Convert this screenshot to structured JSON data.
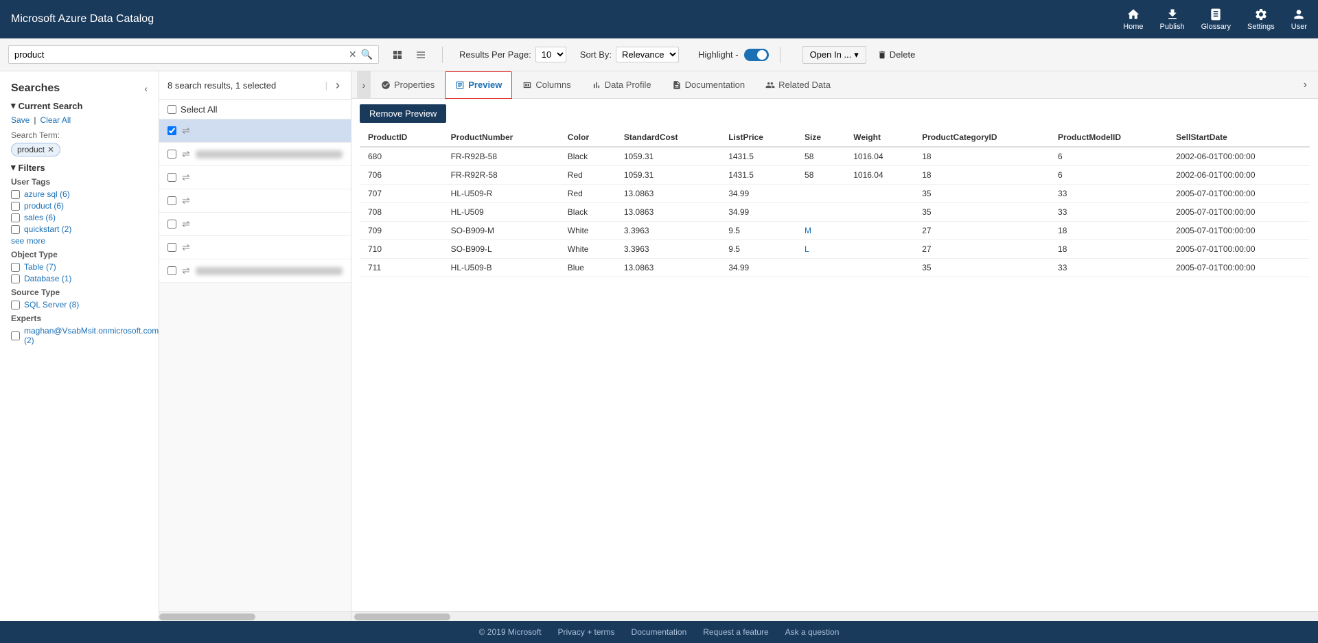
{
  "app": {
    "title": "Microsoft Azure Data Catalog"
  },
  "nav": {
    "home_label": "Home",
    "publish_label": "Publish",
    "glossary_label": "Glossary",
    "settings_label": "Settings",
    "user_label": "User"
  },
  "search_bar": {
    "query": "product",
    "results_per_page_label": "Results Per Page:",
    "results_per_page_value": "10",
    "sort_by_label": "Sort By:",
    "sort_by_value": "Relevance",
    "highlight_label": "Highlight -",
    "open_in_label": "Open In ...",
    "delete_label": "Delete"
  },
  "sidebar": {
    "title": "Searches",
    "current_search_label": "Current Search",
    "save_label": "Save",
    "clear_all_label": "Clear All",
    "search_term_label": "Search Term:",
    "search_term_value": "product",
    "filters_label": "Filters",
    "user_tags_label": "User Tags",
    "filters": [
      {
        "label": "azure sql",
        "count": 6
      },
      {
        "label": "product",
        "count": 6
      },
      {
        "label": "sales",
        "count": 6
      },
      {
        "label": "quickstart",
        "count": 2
      }
    ],
    "see_more": "see more",
    "object_type_label": "Object Type",
    "object_types": [
      {
        "label": "Table",
        "count": 7
      },
      {
        "label": "Database",
        "count": 1
      }
    ],
    "source_type_label": "Source Type",
    "source_types": [
      {
        "label": "SQL Server",
        "count": 8
      }
    ],
    "experts_label": "Experts",
    "experts_email": "maghan@VsabMsit.onmicrosoft.com",
    "experts_count": "(2)"
  },
  "results": {
    "summary": "8 search results, 1 selected",
    "select_all_label": "Select All",
    "items": [
      {
        "id": 1,
        "selected": true,
        "blurred": false,
        "text": ""
      },
      {
        "id": 2,
        "selected": false,
        "blurred": true,
        "text": "blurred item 2"
      },
      {
        "id": 3,
        "selected": false,
        "blurred": false,
        "text": ""
      },
      {
        "id": 4,
        "selected": false,
        "blurred": false,
        "text": ""
      },
      {
        "id": 5,
        "selected": false,
        "blurred": false,
        "text": ""
      },
      {
        "id": 6,
        "selected": false,
        "blurred": false,
        "text": ""
      },
      {
        "id": 7,
        "selected": false,
        "blurred": true,
        "text": "blurred item 7"
      }
    ]
  },
  "detail": {
    "tabs": [
      {
        "id": "properties",
        "label": "Properties",
        "active": false
      },
      {
        "id": "preview",
        "label": "Preview",
        "active": true
      },
      {
        "id": "columns",
        "label": "Columns",
        "active": false
      },
      {
        "id": "data-profile",
        "label": "Data Profile",
        "active": false
      },
      {
        "id": "documentation",
        "label": "Documentation",
        "active": false
      },
      {
        "id": "related-data",
        "label": "Related Data",
        "active": false
      }
    ],
    "remove_preview_label": "Remove Preview",
    "table": {
      "columns": [
        "ProductID",
        "ProductNumber",
        "Color",
        "StandardCost",
        "ListPrice",
        "Size",
        "Weight",
        "ProductCategoryID",
        "ProductModelID",
        "SellStartDate"
      ],
      "rows": [
        {
          "ProductID": "680",
          "ProductNumber": "FR-R92B-58",
          "Color": "Black",
          "StandardCost": "1059.31",
          "ListPrice": "1431.5",
          "Size": "58",
          "Weight": "1016.04",
          "ProductCategoryID": "18",
          "ProductModelID": "6",
          "SellStartDate": "2002-06-01T00:00:00"
        },
        {
          "ProductID": "706",
          "ProductNumber": "FR-R92R-58",
          "Color": "Red",
          "StandardCost": "1059.31",
          "ListPrice": "1431.5",
          "Size": "58",
          "Weight": "1016.04",
          "ProductCategoryID": "18",
          "ProductModelID": "6",
          "SellStartDate": "2002-06-01T00:00:00"
        },
        {
          "ProductID": "707",
          "ProductNumber": "HL-U509-R",
          "Color": "Red",
          "StandardCost": "13.0863",
          "ListPrice": "34.99",
          "Size": "",
          "Weight": "",
          "ProductCategoryID": "35",
          "ProductModelID": "33",
          "SellStartDate": "2005-07-01T00:00:00"
        },
        {
          "ProductID": "708",
          "ProductNumber": "HL-U509",
          "Color": "Black",
          "StandardCost": "13.0863",
          "ListPrice": "34.99",
          "Size": "",
          "Weight": "",
          "ProductCategoryID": "35",
          "ProductModelID": "33",
          "SellStartDate": "2005-07-01T00:00:00"
        },
        {
          "ProductID": "709",
          "ProductNumber": "SO-B909-M",
          "Color": "White",
          "StandardCost": "3.3963",
          "ListPrice": "9.5",
          "Size": "M",
          "Weight": "",
          "ProductCategoryID": "27",
          "ProductModelID": "18",
          "SellStartDate": "2005-07-01T00:00:00"
        },
        {
          "ProductID": "710",
          "ProductNumber": "SO-B909-L",
          "Color": "White",
          "StandardCost": "3.3963",
          "ListPrice": "9.5",
          "Size": "L",
          "Weight": "",
          "ProductCategoryID": "27",
          "ProductModelID": "18",
          "SellStartDate": "2005-07-01T00:00:00"
        },
        {
          "ProductID": "711",
          "ProductNumber": "HL-U509-B",
          "Color": "Blue",
          "StandardCost": "13.0863",
          "ListPrice": "34.99",
          "Size": "",
          "Weight": "",
          "ProductCategoryID": "35",
          "ProductModelID": "33",
          "SellStartDate": "2005-07-01T00:00:00"
        }
      ]
    }
  },
  "footer": {
    "copyright": "© 2019 Microsoft",
    "privacy_label": "Privacy + terms",
    "documentation_label": "Documentation",
    "request_label": "Request a feature",
    "ask_label": "Ask a question"
  }
}
